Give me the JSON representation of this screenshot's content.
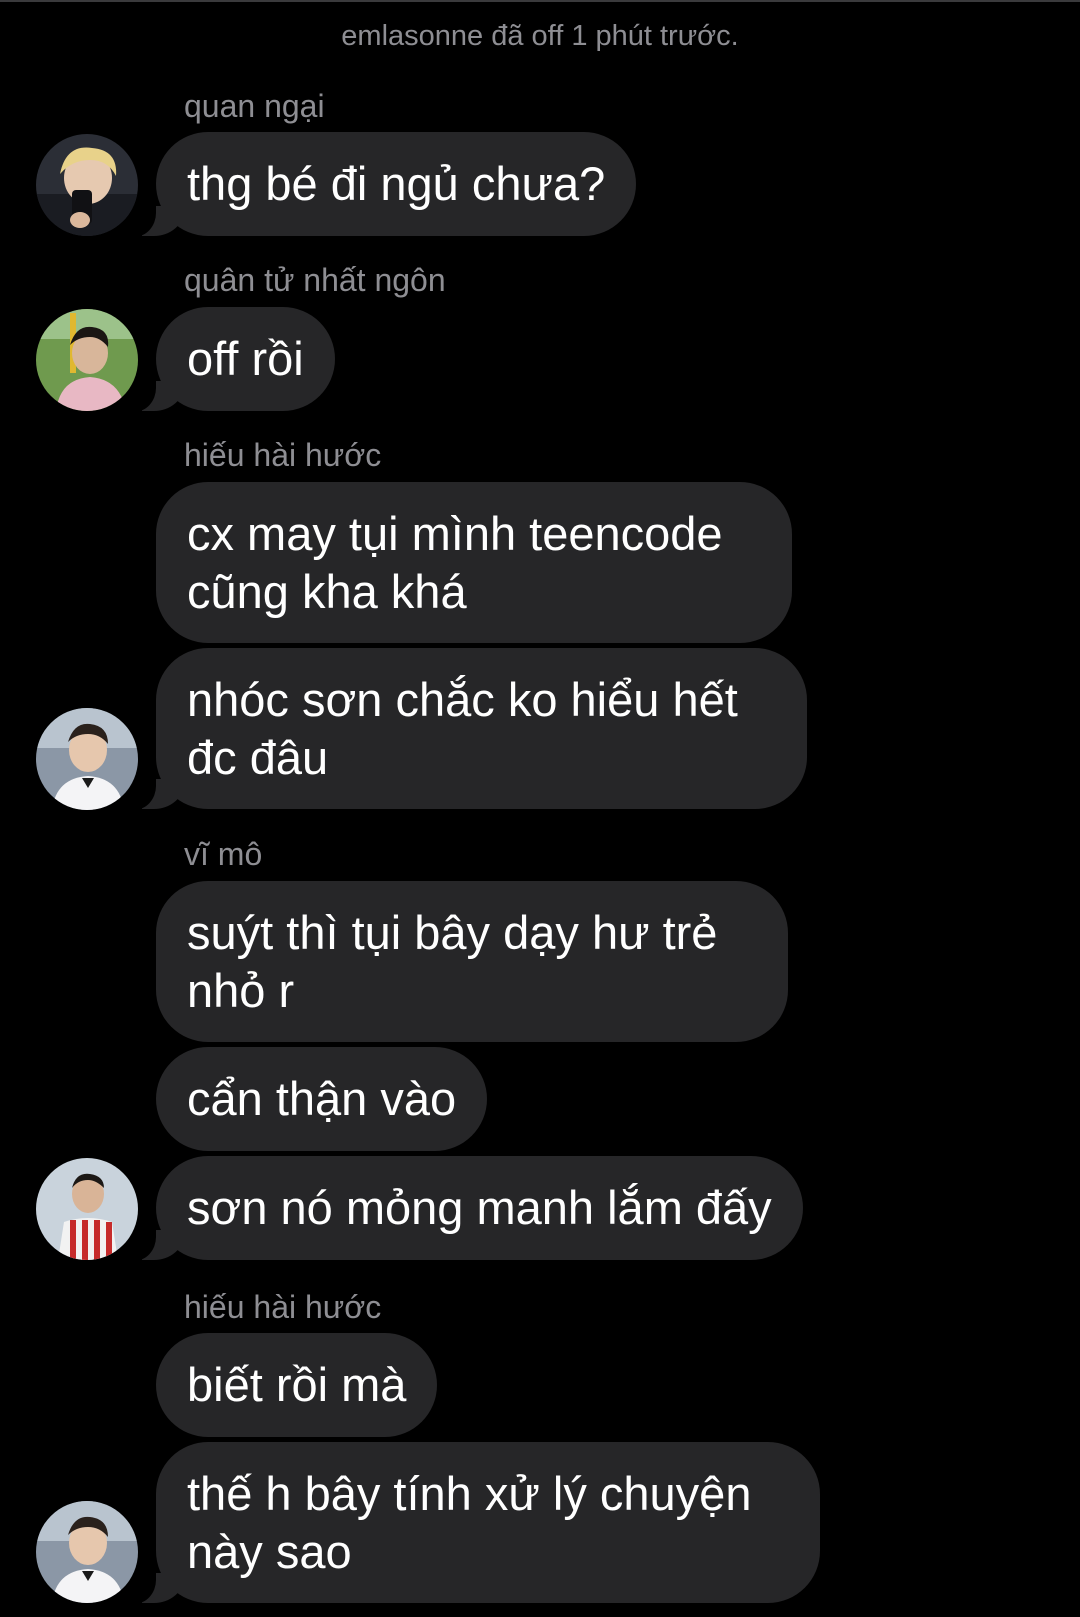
{
  "status": {
    "text": "emlasonne đã off 1 phút trước."
  },
  "messages": [
    {
      "sender": "quan ngại",
      "text": "thg bé đi ngủ chưa?"
    },
    {
      "sender": "quân tử nhất ngôn",
      "text": "off rồi"
    },
    {
      "sender": "hiếu hài hước",
      "text": "cx may tụi mình teencode\ncũng kha khá"
    },
    {
      "sender": "",
      "text": "nhóc sơn chắc ko hiểu hết\nđc đâu"
    },
    {
      "sender": "vĩ mô",
      "text": "suýt thì tụi bây dạy hư trẻ\nnhỏ r"
    },
    {
      "sender": "",
      "text": "cẩn thận vào"
    },
    {
      "sender": "",
      "text": "sơn nó mỏng manh lắm đấy"
    },
    {
      "sender": "hiếu hài hước",
      "text": "biết rồi mà"
    },
    {
      "sender": "",
      "text": "thế h bây tính xử lý chuyện\nnày sao"
    }
  ],
  "colors": {
    "background": "#000000",
    "bubble": "#262628",
    "sender_name": "#8e8e93",
    "message_text": "#ffffff"
  }
}
